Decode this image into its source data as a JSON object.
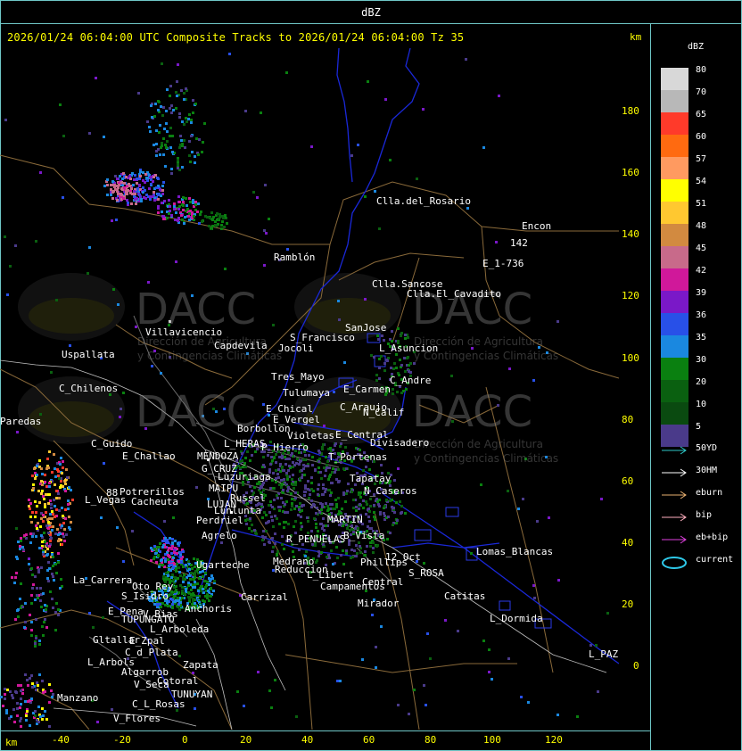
{
  "window": {
    "title": "dBZ"
  },
  "header": {
    "text": "2026/01/24 06:04:00 UTC Composite Tracks to 2026/01/24 06:04:00 Tz 35",
    "km_label": "km"
  },
  "axes": {
    "x_label": "km",
    "x_ticks": [
      "-40",
      "-20",
      "0",
      "20",
      "40",
      "60",
      "80",
      "100",
      "120"
    ],
    "y_ticks": [
      "180",
      "160",
      "140",
      "120",
      "100",
      "80",
      "60",
      "40",
      "20",
      "0"
    ]
  },
  "legend": {
    "title": "dBZ",
    "levels": [
      {
        "value": "80",
        "color": "#d8d8d8"
      },
      {
        "value": "70",
        "color": "#b8b8b8"
      },
      {
        "value": "65",
        "color": "#ff3a2a"
      },
      {
        "value": "60",
        "color": "#ff6a10"
      },
      {
        "value": "57",
        "color": "#ff9a60"
      },
      {
        "value": "54",
        "color": "#ffff00"
      },
      {
        "value": "51",
        "color": "#ffc830"
      },
      {
        "value": "48",
        "color": "#d28a40"
      },
      {
        "value": "45",
        "color": "#c86a8a"
      },
      {
        "value": "42",
        "color": "#d0189a"
      },
      {
        "value": "39",
        "color": "#7a18c8"
      },
      {
        "value": "36",
        "color": "#2850e8"
      },
      {
        "value": "35",
        "color": "#1a88e0"
      },
      {
        "value": "30",
        "color": "#0a8010"
      },
      {
        "value": "20",
        "color": "#0a6010"
      },
      {
        "value": "10",
        "color": "#0a4a10"
      },
      {
        "value": "5",
        "color": "#4a3a8a"
      }
    ],
    "tracks": [
      {
        "label": "50YD",
        "color": "#2ec8c8",
        "icon": "arrow-icon"
      },
      {
        "label": "30HM",
        "color": "#ffffff",
        "icon": "arrow-icon"
      },
      {
        "label": "eburn",
        "color": "#e8b070",
        "icon": "arrow-icon"
      },
      {
        "label": "bip",
        "color": "#ffb0c0",
        "icon": "arrow-icon"
      },
      {
        "label": "eb+bip",
        "color": "#e040e0",
        "icon": "arrow-icon"
      },
      {
        "label": "current",
        "color": "#2ec8e8",
        "icon": "ellipse-icon"
      }
    ]
  },
  "watermark": {
    "brand": "DACC",
    "line1": "Dirección de Agricultura",
    "line2": "y Contingencias Climáticas"
  },
  "places": [
    {
      "name": "Clla.del_Rosario"
    },
    {
      "name": "Encon"
    },
    {
      "name": "142"
    },
    {
      "name": "E_1-736"
    },
    {
      "name": "Ramblón"
    },
    {
      "name": "Clla.Sanɕose"
    },
    {
      "name": "Clla.El_Cavadito"
    },
    {
      "name": "Villavicencio"
    },
    {
      "name": "Uspallata"
    },
    {
      "name": "Capdevila"
    },
    {
      "name": "S_Francisco"
    },
    {
      "name": "Jocoli"
    },
    {
      "name": "SanJose"
    },
    {
      "name": "L_Asuncion"
    },
    {
      "name": "Tres_Mayo"
    },
    {
      "name": "C_Chilenos"
    },
    {
      "name": "Tulumaya"
    },
    {
      "name": "C_Andre"
    },
    {
      "name": "E_Carmen"
    },
    {
      "name": "E_Chical"
    },
    {
      "name": "E_Vergel"
    },
    {
      "name": "C_Araujo"
    },
    {
      "name": "N_Calif"
    },
    {
      "name": "Borbollon"
    },
    {
      "name": "Violetas"
    },
    {
      "name": "E_Central"
    },
    {
      "name": "Divisadero"
    },
    {
      "name": "L_HERAS"
    },
    {
      "name": "P_Hierro"
    },
    {
      "name": "C_Guido"
    },
    {
      "name": "E_Challao"
    },
    {
      "name": "MENDOZA"
    },
    {
      "name": "T_Portenas"
    },
    {
      "name": "G_CRUZ"
    },
    {
      "name": "Luzuriaga"
    },
    {
      "name": "Tapatay"
    },
    {
      "name": "MAIPU"
    },
    {
      "name": "Russel"
    },
    {
      "name": "N_Caseros"
    },
    {
      "name": "Potrerillos"
    },
    {
      "name": "L_Vegas"
    },
    {
      "name": "Cacheuta"
    },
    {
      "name": "LUJAN"
    },
    {
      "name": "Lunlunta"
    },
    {
      "name": "Perdriel"
    },
    {
      "name": "MARTIN"
    },
    {
      "name": "Agrelo"
    },
    {
      "name": "R_PENUELAS"
    },
    {
      "name": "B_Vista"
    },
    {
      "name": "Ugarteche"
    },
    {
      "name": "Medrano"
    },
    {
      "name": "Reduccion"
    },
    {
      "name": "Phillips"
    },
    {
      "name": "12_Oct"
    },
    {
      "name": "Lomas_Blancas"
    },
    {
      "name": "S_ROSA"
    },
    {
      "name": "L_Libert"
    },
    {
      "name": "Campamentos"
    },
    {
      "name": "Central"
    },
    {
      "name": "La_Carrera"
    },
    {
      "name": "Oto_Rey"
    },
    {
      "name": "S_Isidro"
    },
    {
      "name": "Carrizal"
    },
    {
      "name": "Catitas"
    },
    {
      "name": "Anchoris"
    },
    {
      "name": "Mirador"
    },
    {
      "name": "E_Pena"
    },
    {
      "name": "V_Bias"
    },
    {
      "name": "TUPUNGATO"
    },
    {
      "name": "L_Dormida"
    },
    {
      "name": "L_Arboleda"
    },
    {
      "name": "Gltallar"
    },
    {
      "name": "E_Zpal"
    },
    {
      "name": "C_d_Plata"
    },
    {
      "name": "L_Arbols"
    },
    {
      "name": "Zapata"
    },
    {
      "name": "Algarrob"
    },
    {
      "name": "V_Seca"
    },
    {
      "name": "Cotoral"
    },
    {
      "name": "TUNUYAN"
    },
    {
      "name": "Manzano"
    },
    {
      "name": "C_L_Rosas"
    },
    {
      "name": "V_Flores"
    },
    {
      "name": "L_PAZ"
    },
    {
      "name": "Paredas"
    },
    {
      "name": "88"
    }
  ]
}
